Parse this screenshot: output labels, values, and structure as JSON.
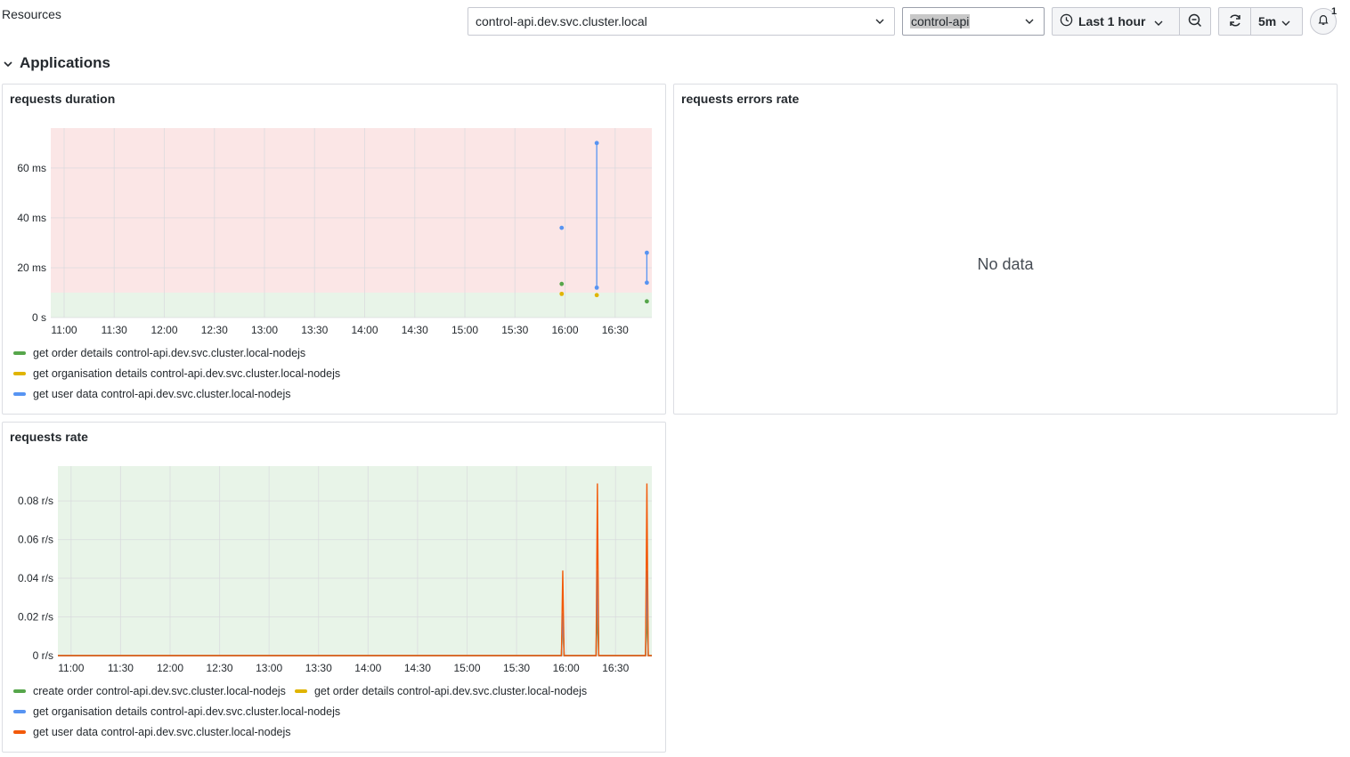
{
  "header": {
    "title": "Resources",
    "host_select": "control-api.dev.svc.cluster.local",
    "service_select": "control-api",
    "time_range": "Last 1 hour",
    "refresh_interval": "5m",
    "alerts_count": "1"
  },
  "row": {
    "title": "Applications"
  },
  "colors": {
    "green": "#56a64b",
    "yellow": "#e0b400",
    "blue": "#5794f2",
    "orange": "#f2590a",
    "threshold_red": "#fbe6e6",
    "threshold_green": "#e8f4e8"
  },
  "panels": {
    "duration": {
      "title": "requests duration",
      "legend": [
        {
          "label": "get order details control-api.dev.svc.cluster.local-nodejs",
          "color": "#56a64b"
        },
        {
          "label": "get organisation details control-api.dev.svc.cluster.local-nodejs",
          "color": "#e0b400"
        },
        {
          "label": "get user data control-api.dev.svc.cluster.local-nodejs",
          "color": "#5794f2"
        }
      ]
    },
    "errors": {
      "title": "requests errors rate",
      "no_data": "No data"
    },
    "rate": {
      "title": "requests rate",
      "legend": [
        {
          "label": "create order control-api.dev.svc.cluster.local-nodejs",
          "color": "#56a64b"
        },
        {
          "label": "get order details control-api.dev.svc.cluster.local-nodejs",
          "color": "#e0b400"
        },
        {
          "label": "get organisation details control-api.dev.svc.cluster.local-nodejs",
          "color": "#5794f2"
        },
        {
          "label": "get user data control-api.dev.svc.cluster.local-nodejs",
          "color": "#f2590a"
        }
      ]
    }
  },
  "chart_data": [
    {
      "type": "scatter",
      "title": "requests duration",
      "xlabel": "",
      "ylabel": "",
      "x_ticks": [
        "11:00",
        "11:30",
        "12:00",
        "12:30",
        "13:00",
        "13:30",
        "14:00",
        "14:30",
        "15:00",
        "15:30",
        "16:00",
        "16:30"
      ],
      "y_ticks": [
        "0 s",
        "20 ms",
        "40 ms",
        "60 ms"
      ],
      "xlim": [
        "10:52",
        "16:52"
      ],
      "ylim": [
        0,
        76
      ],
      "threshold": 10,
      "grid": true,
      "legend_position": "bottom",
      "series": [
        {
          "name": "get order details control-api.dev.svc.cluster.local-nodejs",
          "color": "#56a64b",
          "points": [
            [
              "15:58",
              13.5
            ],
            [
              "16:49",
              6.5
            ]
          ]
        },
        {
          "name": "get organisation details control-api.dev.svc.cluster.local-nodejs",
          "color": "#e0b400",
          "points": [
            [
              "15:58",
              9.5
            ],
            [
              "16:19",
              9
            ]
          ]
        },
        {
          "name": "get user data control-api.dev.svc.cluster.local-nodejs",
          "color": "#5794f2",
          "points": [
            [
              "15:58",
              36
            ],
            [
              "16:19",
              70
            ],
            [
              "16:19",
              12
            ],
            [
              "16:49",
              26
            ],
            [
              "16:49",
              14
            ]
          ]
        }
      ]
    },
    {
      "type": "line",
      "title": "requests rate",
      "xlabel": "",
      "ylabel": "",
      "x_ticks": [
        "11:00",
        "11:30",
        "12:00",
        "12:30",
        "13:00",
        "13:30",
        "14:00",
        "14:30",
        "15:00",
        "15:30",
        "16:00",
        "16:30"
      ],
      "y_ticks": [
        "0 r/s",
        "0.02 r/s",
        "0.04 r/s",
        "0.06 r/s",
        "0.08 r/s"
      ],
      "xlim": [
        "10:52",
        "16:52"
      ],
      "ylim": [
        0,
        0.098
      ],
      "grid": true,
      "legend_position": "bottom",
      "series": [
        {
          "name": "create order control-api.dev.svc.cluster.local-nodejs",
          "color": "#56a64b",
          "spikes": [
            [
              "15:58",
              0.022
            ],
            [
              "16:19",
              0.022
            ],
            [
              "16:49",
              0.022
            ]
          ]
        },
        {
          "name": "get order details control-api.dev.svc.cluster.local-nodejs",
          "color": "#e0b400",
          "spikes": [
            [
              "15:58",
              0.022
            ],
            [
              "16:19",
              0.044
            ],
            [
              "16:49",
              0.044
            ]
          ]
        },
        {
          "name": "get organisation details control-api.dev.svc.cluster.local-nodejs",
          "color": "#5794f2",
          "spikes": [
            [
              "15:58",
              0.022
            ],
            [
              "16:19",
              0.044
            ],
            [
              "16:49",
              0.044
            ]
          ]
        },
        {
          "name": "get user data control-api.dev.svc.cluster.local-nodejs",
          "color": "#f2590a",
          "spikes": [
            [
              "15:58",
              0.044
            ],
            [
              "16:19",
              0.089
            ],
            [
              "16:49",
              0.089
            ]
          ]
        }
      ]
    }
  ]
}
